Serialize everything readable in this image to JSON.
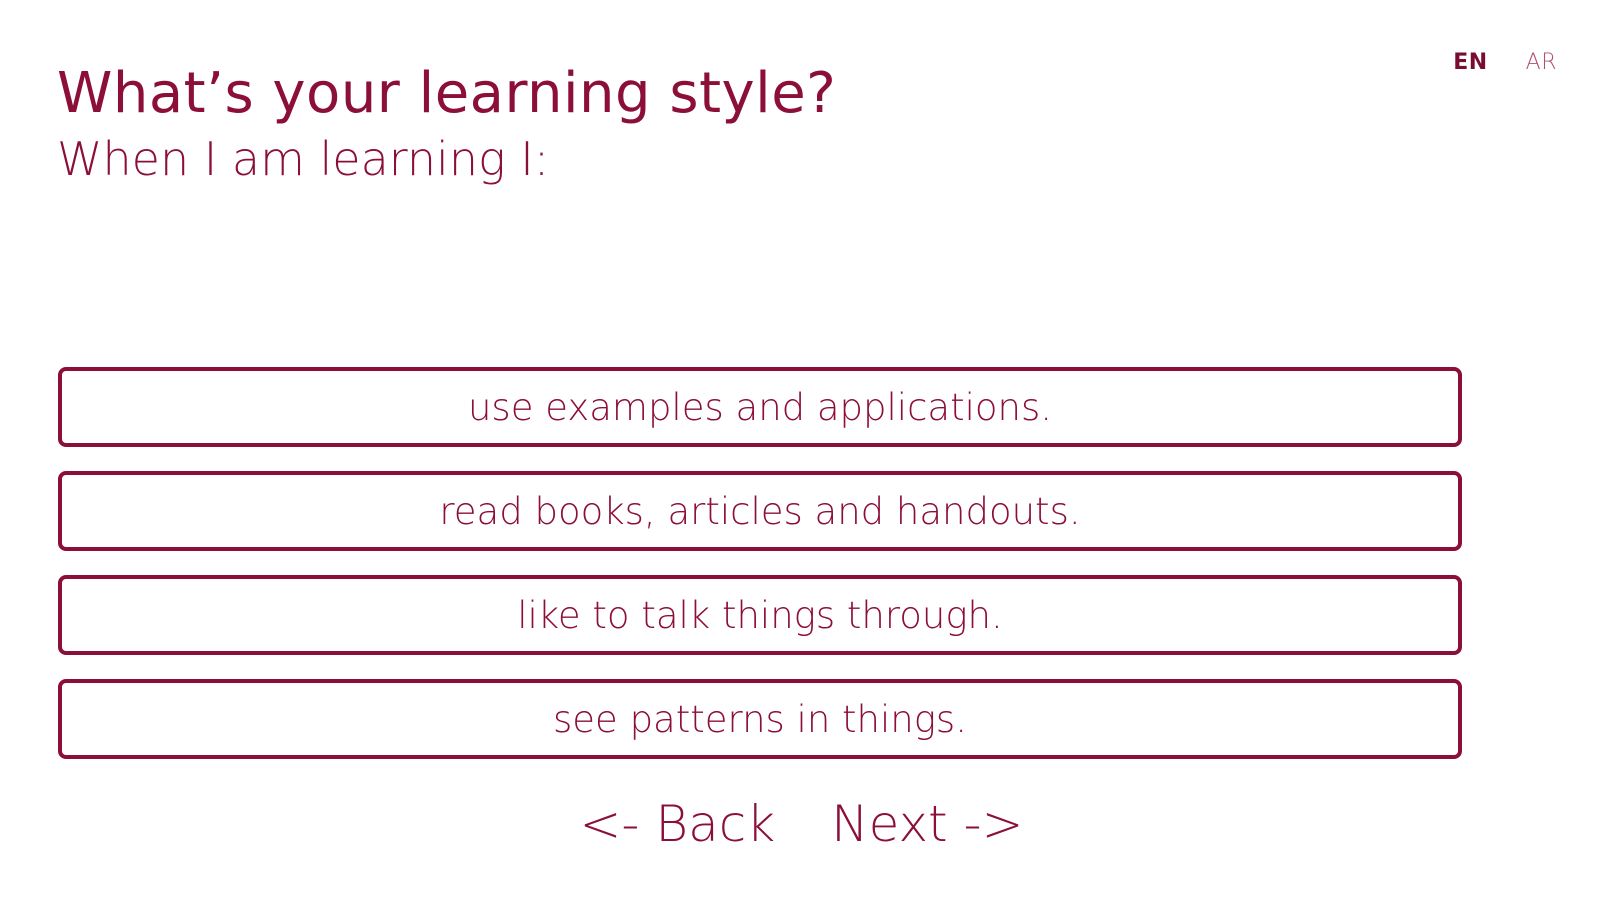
{
  "language": {
    "active": "EN",
    "inactive": "AR"
  },
  "question": {
    "title": "What’s your learning style?",
    "prompt": "When I am learning I:"
  },
  "options": [
    {
      "label": "use examples and applications."
    },
    {
      "label": "read books, articles and handouts."
    },
    {
      "label": "like to talk things through."
    },
    {
      "label": "see patterns in things."
    }
  ],
  "navigation": {
    "back_label": "<- Back",
    "next_label": "Next ->"
  },
  "colors": {
    "accent": "#8c0f38",
    "background": "#ffffff"
  }
}
